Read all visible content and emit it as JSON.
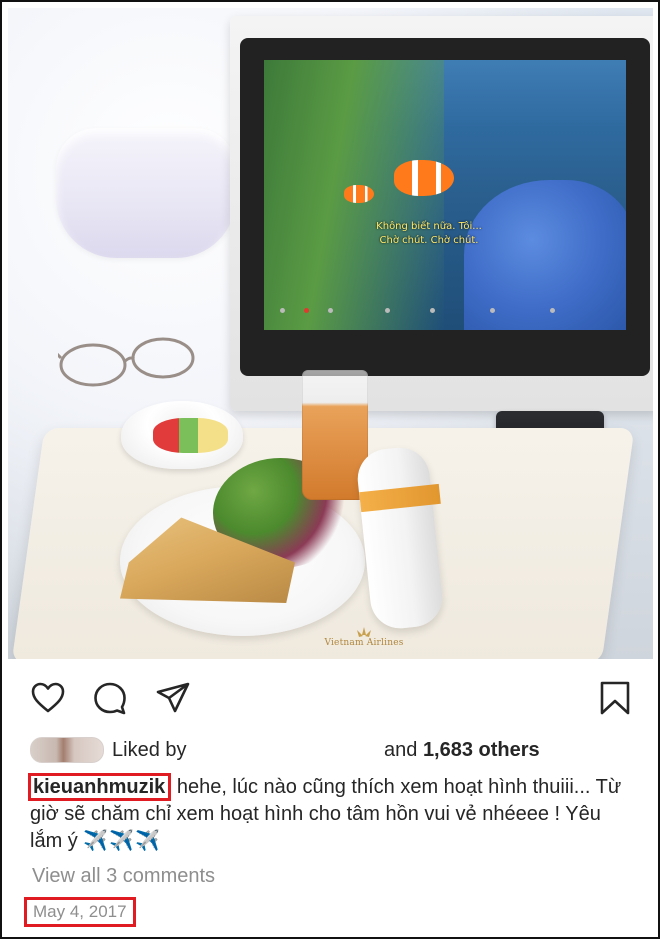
{
  "photo": {
    "subtitle_line1": "Không biết nữa. Tôi...",
    "subtitle_line2": "Chờ chút. Chờ chút.",
    "airline_name": "Vietnam Airlines"
  },
  "actions": {
    "icons": [
      "heart-icon",
      "comment-icon",
      "share-icon",
      "bookmark-icon"
    ]
  },
  "likes": {
    "prefix": "Liked by",
    "suffix_pre": "and ",
    "count": "1,683 others"
  },
  "caption": {
    "username": "kieuanhmuzik",
    "text": "hehe, lúc nào cũng thích xem hoạt hình thuiii... Từ giờ sẽ chăm chỉ xem hoạt hình cho tâm hồn vui vẻ nhéeee ! Yêu lắm ý",
    "emoji": "✈️✈️✈️"
  },
  "comments": {
    "view_all": "View all 3 comments"
  },
  "post": {
    "date": "May 4, 2017"
  },
  "colors": {
    "highlight": "#e01b22",
    "text": "#262626",
    "muted": "#8e8e8e"
  }
}
